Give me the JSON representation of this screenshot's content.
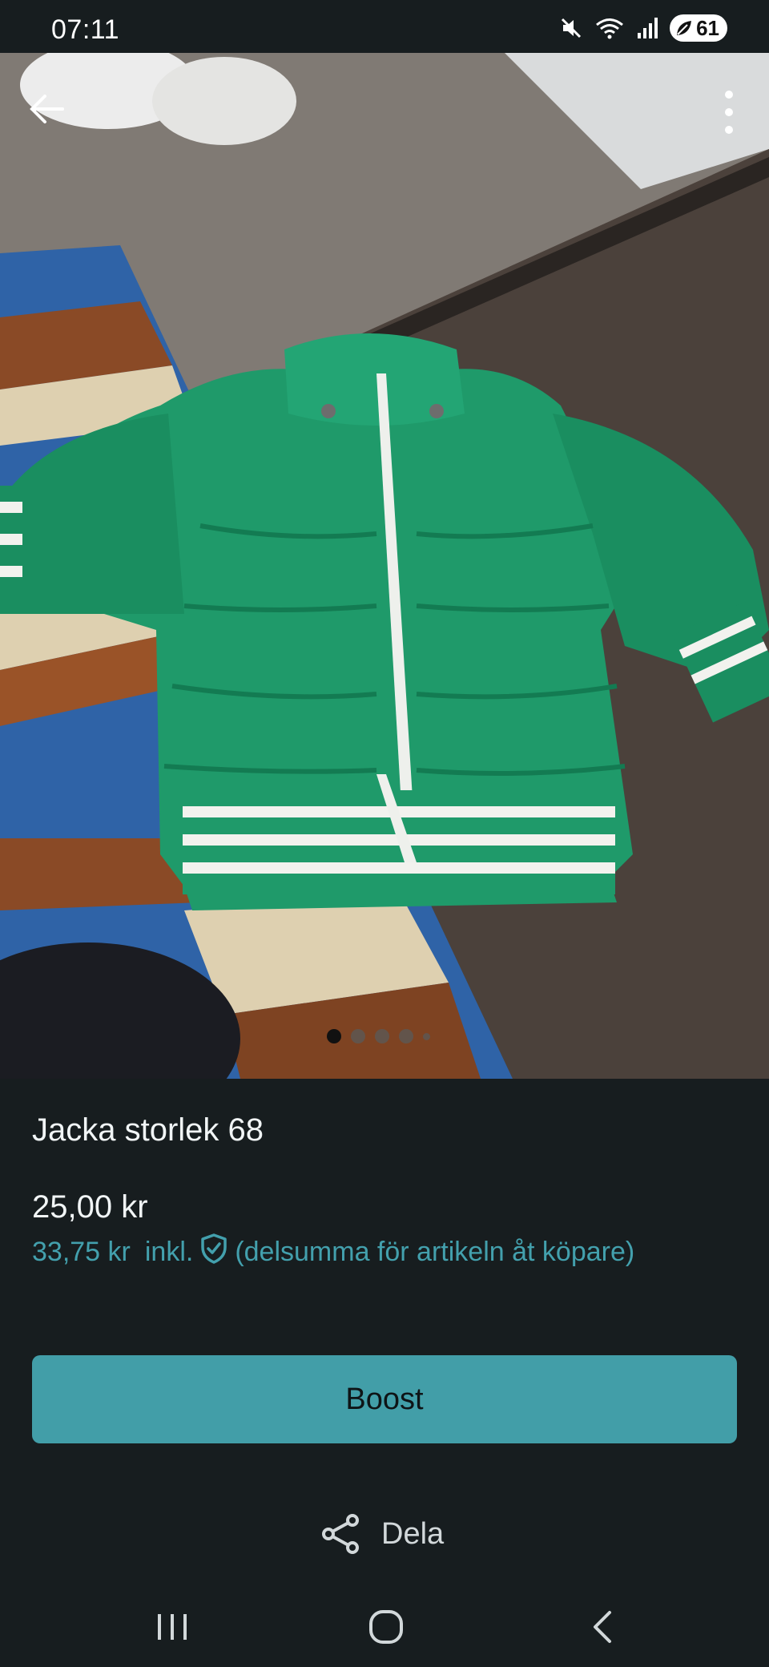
{
  "status_bar": {
    "time": "07:11",
    "battery": "61",
    "icons": [
      "mute-icon",
      "wifi-icon",
      "signal-icon",
      "battery-icon"
    ]
  },
  "photo": {
    "description_icons": [
      "back-arrow-icon",
      "more-vertical-icon"
    ],
    "carousel": {
      "count": 5,
      "active_index": 0
    }
  },
  "listing": {
    "title": "Jacka storlek 68",
    "price": "25,00 kr",
    "price_with_fee": "33,75 kr",
    "incl_label": "inkl.",
    "fee_note": "(delsumma för artikeln åt köpare)"
  },
  "actions": {
    "boost_label": "Boost",
    "share_label": "Dela"
  },
  "colors": {
    "background": "#171d1f",
    "accent": "#429ea8",
    "accent_text": "#43a0ad"
  },
  "navbar": {
    "icons": [
      "recent-apps-icon",
      "home-icon",
      "back-icon"
    ]
  }
}
